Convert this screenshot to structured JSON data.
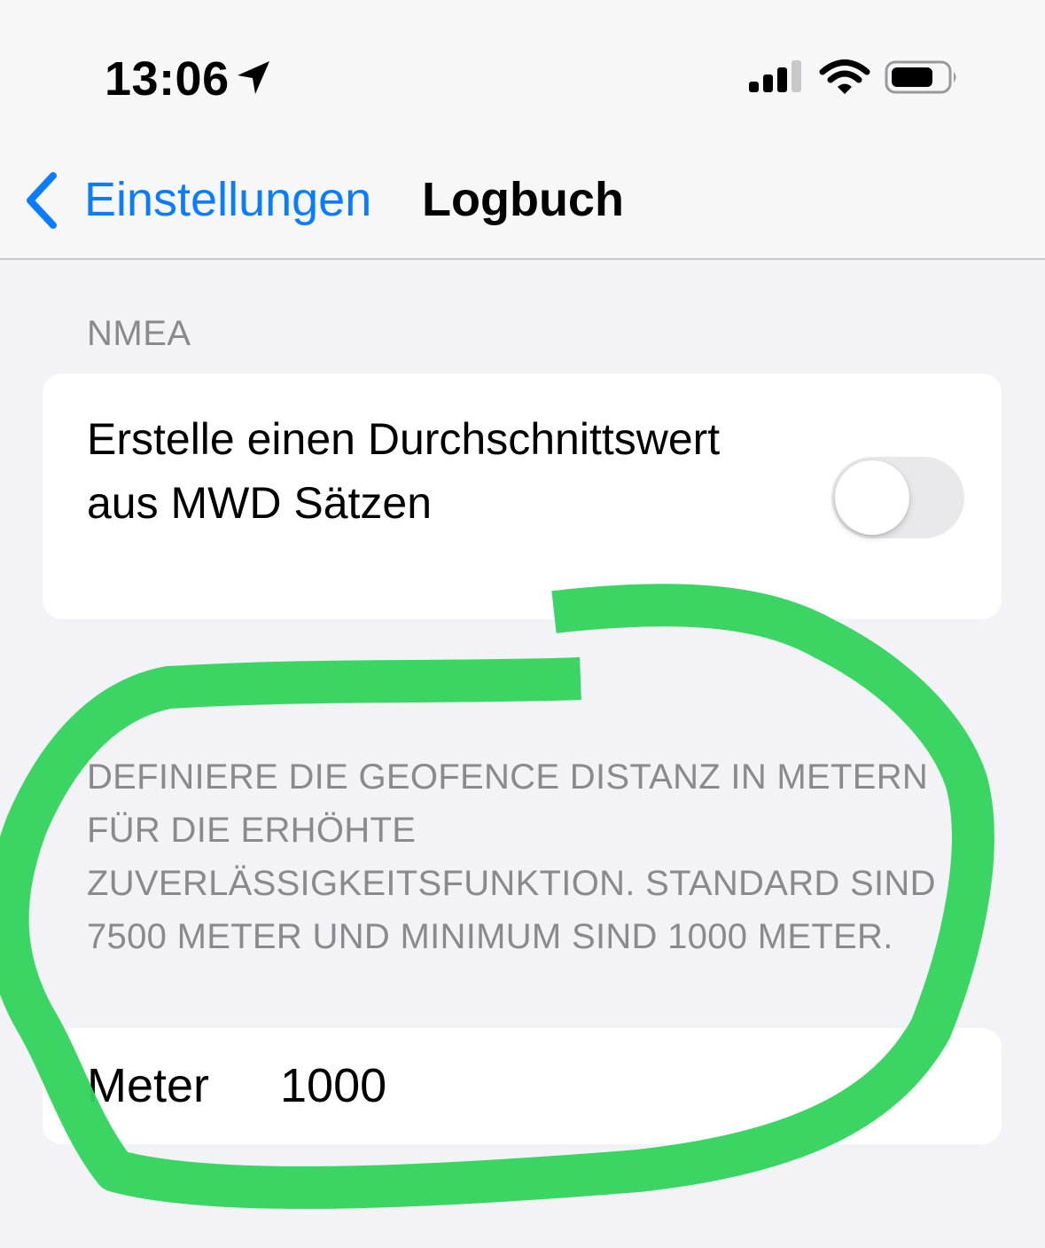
{
  "status_bar": {
    "time": "13:06",
    "icons": [
      "location-arrow-icon",
      "cellular-signal-icon",
      "wifi-icon",
      "battery-icon"
    ]
  },
  "nav": {
    "back_label": "Einstellungen",
    "title": "Logbuch"
  },
  "nmea_section": {
    "header": "NMEA",
    "toggle_label": "Erstelle einen Durchschnittswert aus MWD Sätzen",
    "toggle_on": false
  },
  "geofence_section": {
    "footer": "DEFINIERE DIE GEOFENCE DISTANZ IN METERN FÜR DIE ERHÖHTE ZUVERLÄSSIGKEITSFUNKTION. STANDARD SIND 7500 METER UND MINIMUM SIND 1000 METER.",
    "field_label": "Meter",
    "field_value": "1000"
  },
  "colors": {
    "accent": "#0a7cff",
    "background": "#f2f2f7",
    "annotation_green": "#2fd35a"
  }
}
